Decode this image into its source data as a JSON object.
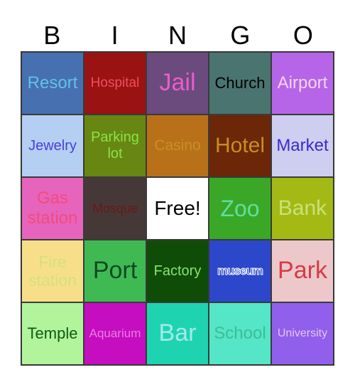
{
  "header": {
    "letters": [
      "B",
      "I",
      "N",
      "G",
      "O"
    ]
  },
  "cells": [
    {
      "label": "Resort",
      "bg": "#4670b0",
      "color": "#62c2e6",
      "size": 24
    },
    {
      "label": "Hospital",
      "bg": "#9a1212",
      "color": "#f04f5e",
      "size": 19
    },
    {
      "label": "Jail",
      "bg": "#6b4a7e",
      "color": "#e85ec8",
      "size": 34
    },
    {
      "label": "Church",
      "bg": "#4a7470",
      "color": "#000000",
      "size": 22
    },
    {
      "label": "Airport",
      "bg": "#b665e8",
      "color": "#f4d4f0",
      "size": 24
    },
    {
      "label": "Jewelry",
      "bg": "#b4cff2",
      "color": "#4a3ee0",
      "size": 20
    },
    {
      "label": "Parking\nlot",
      "bg": "#678612",
      "color": "#8ae444",
      "size": 20
    },
    {
      "label": "Casino",
      "bg": "#b87118",
      "color": "#c69028",
      "size": 21
    },
    {
      "label": "Hotel",
      "bg": "#6b2707",
      "color": "#c6901e",
      "size": 30
    },
    {
      "label": "Market",
      "bg": "#cecef0",
      "color": "#3a2ad0",
      "size": 24
    },
    {
      "label": "Gas\nstation",
      "bg": "#e764bc",
      "color": "#f04c7c",
      "size": 24
    },
    {
      "label": "Mosque",
      "bg": "#473838",
      "color": "#6a1818",
      "size": 18
    },
    {
      "label": "Free!",
      "bg": "#ffffff",
      "color": "#000000",
      "size": 28
    },
    {
      "label": "Zoo",
      "bg": "#3aa826",
      "color": "#5ee0a0",
      "size": 32
    },
    {
      "label": "Bank",
      "bg": "#a5b914",
      "color": "#c8e27a",
      "size": 30
    },
    {
      "label": "Fire\nstation",
      "bg": "#f7df8a",
      "color": "#d4e07e",
      "size": 23
    },
    {
      "label": "Port",
      "bg": "#3fba52",
      "color": "#0f4a22",
      "size": 34
    },
    {
      "label": "Factory",
      "bg": "#0f4c08",
      "color": "#8ae46c",
      "size": 20
    },
    {
      "label": "museum",
      "bg": "#2c47ca",
      "color": "#2c47ca",
      "size": 17,
      "outlined": true
    },
    {
      "label": "Park",
      "bg": "#ecc8cb",
      "color": "#d43c44",
      "size": 34
    },
    {
      "label": "Temple",
      "bg": "#b2f49c",
      "color": "#0f5a12",
      "size": 22
    },
    {
      "label": "Aquarium",
      "bg": "#c40ec0",
      "color": "#ec7ce0",
      "size": 17
    },
    {
      "label": "Bar",
      "bg": "#1ed4b0",
      "color": "#a6e8ee",
      "size": 34
    },
    {
      "label": "School",
      "bg": "#54e6c6",
      "color": "#3cbe96",
      "size": 24
    },
    {
      "label": "University",
      "bg": "#9060ec",
      "color": "#e4c6f4",
      "size": 16
    }
  ]
}
